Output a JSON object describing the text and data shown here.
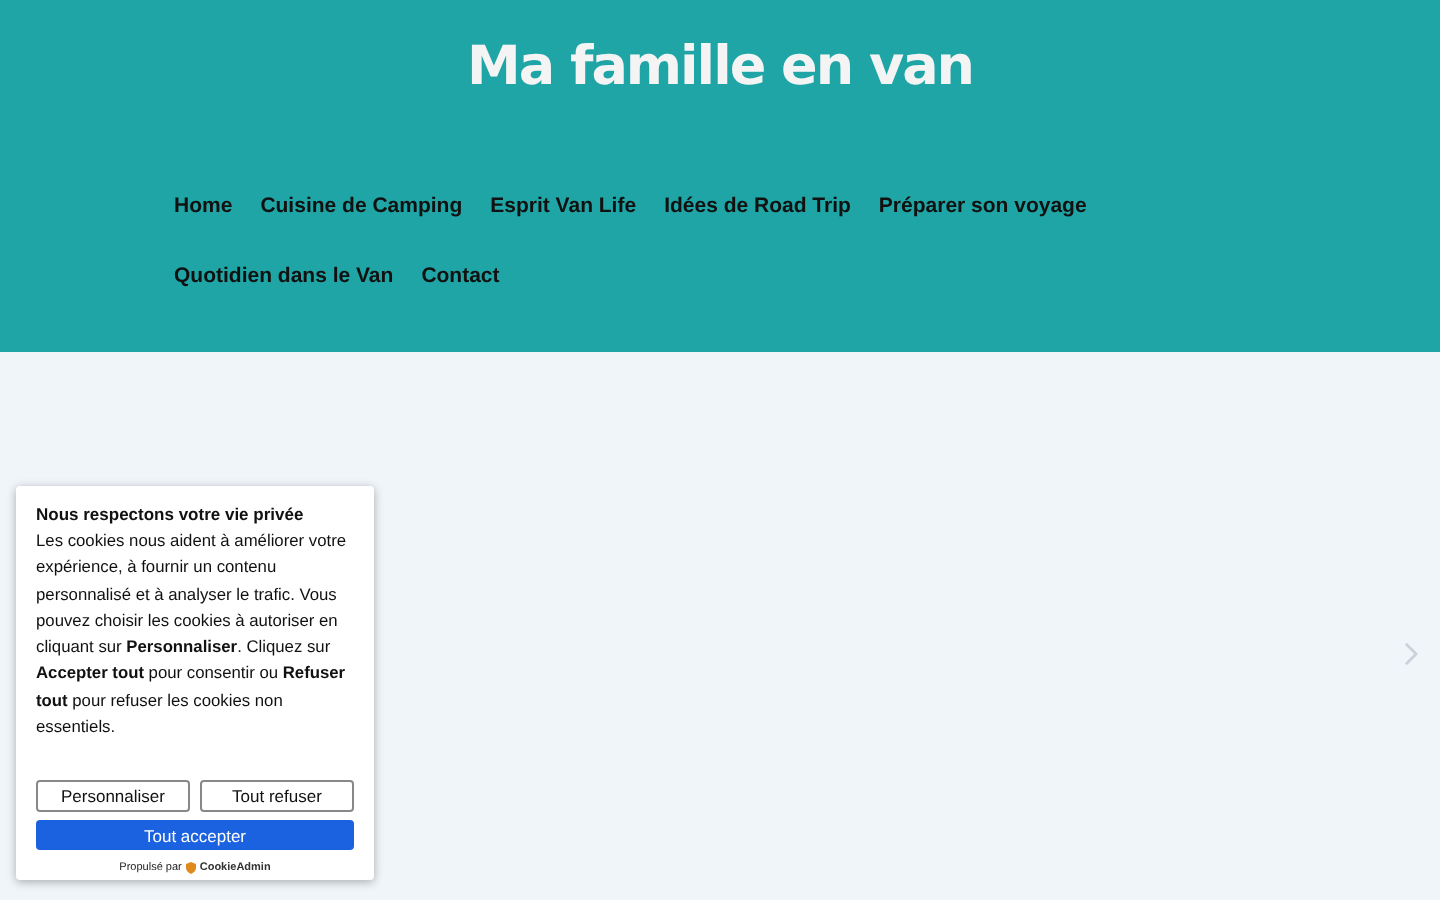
{
  "site_title": "Ma famille en van",
  "nav": [
    "Home",
    "Cuisine de Camping",
    "Esprit Van Life",
    "Idées de Road Trip",
    "Préparer son voyage",
    "Quotidien dans le Van",
    "Contact"
  ],
  "cookie_banner": {
    "title": "Nous respectons votre vie privée",
    "text": "Les cookies nous aident à améliorer votre expérience, à fournir un contenu personnalisé et à analyser le trafic. Vous pouvez choisir les cookies à autoriser en cliquant sur **Personnaliser**. Cliquez sur **Accepter tout** pour consentir ou **Refuser tout** pour refuser les cookies non essentiels.",
    "buttons": [
      {
        "label": "Personnaliser",
        "kind": "secondary"
      },
      {
        "label": "Tout refuser",
        "kind": "secondary"
      },
      {
        "label": "Tout accepter",
        "kind": "primary"
      }
    ],
    "powered_by": "Propulsé par",
    "brand": "CookieAdmin"
  }
}
